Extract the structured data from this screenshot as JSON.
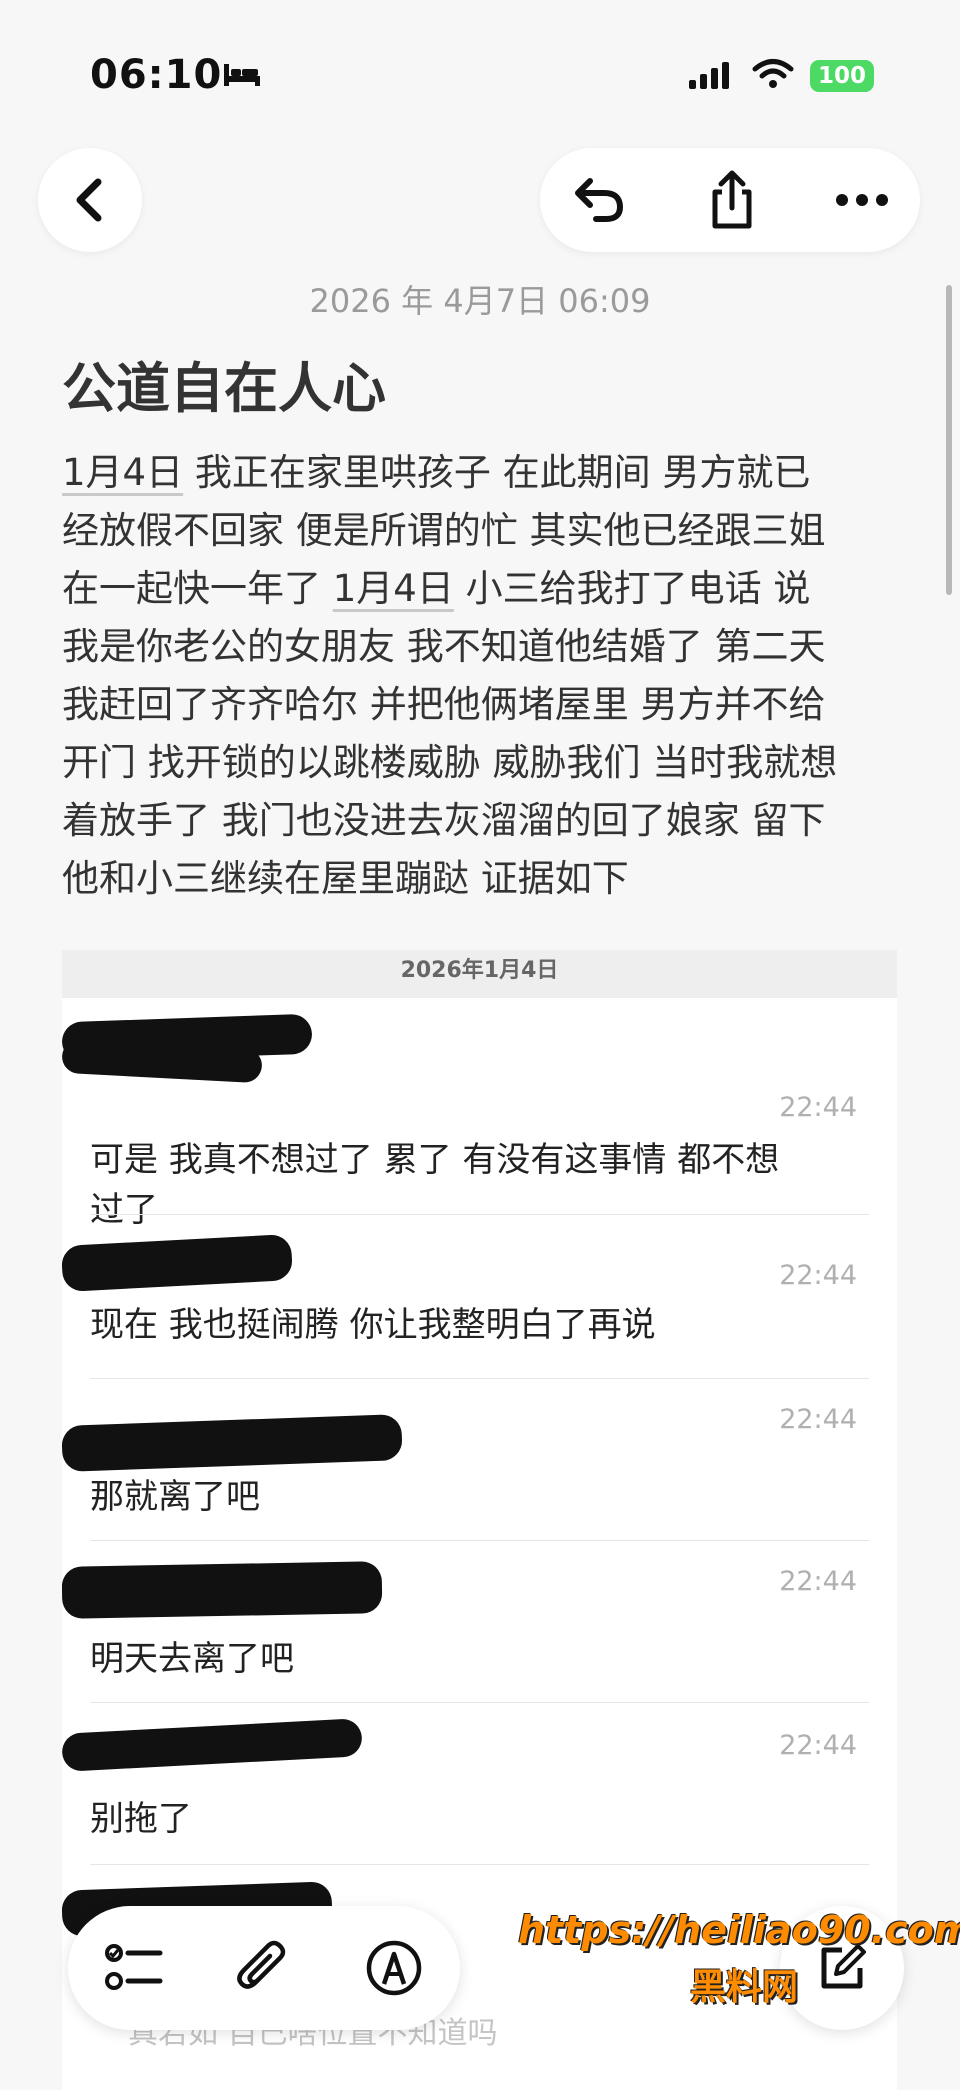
{
  "status_bar": {
    "time": "06:10",
    "battery": "100"
  },
  "toolbar": {
    "back": "back",
    "undo": "undo",
    "share": "share",
    "more": "more"
  },
  "note": {
    "date": "2026 年 4月7日 06:09",
    "title": "公道自在人心",
    "lines": [
      [
        "1月4日",
        " 我正在家里哄孩子 在此期间 男方就已"
      ],
      [
        "",
        "经放假不回家 便是所谓的忙 其实他已经跟三姐"
      ],
      [
        "",
        "在一起快一年了 "
      ],
      [
        "",
        "我是你老公的女朋友 我不知道他结婚了 第二天"
      ],
      [
        "",
        "我赶回了齐齐哈尔 并把他俩堵屋里 男方并不给"
      ],
      [
        "",
        "开门 找开锁的以跳楼威胁 威胁我们 当时我就想"
      ],
      [
        "",
        "着放手了 我门也没进去灰溜溜的回了娘家 留下"
      ],
      [
        "",
        "他和小三继续在屋里蹦跶 证据如下"
      ]
    ],
    "line3_date": "1月4日",
    "line3_tail": " 小三给我打了电话 说"
  },
  "chat": {
    "date": "2026年1月4日",
    "messages": [
      {
        "time": "22:44",
        "text": "可是 我真不想过了 累了 有没有这事情 都不想\n过了"
      },
      {
        "time": "22:44",
        "text": "现在 我也挺闹腾 你让我整明白了再说"
      },
      {
        "time": "22:44",
        "text": "那就离了吧"
      },
      {
        "time": "22:44",
        "text": "明天去离了吧"
      },
      {
        "time": "22:44",
        "text": "别拖了"
      }
    ]
  },
  "bottom": {
    "under_text": "真若如 自己啥位置不知道吗"
  },
  "watermark": {
    "url": "https://heiliao90.com",
    "site": "黑料网"
  }
}
